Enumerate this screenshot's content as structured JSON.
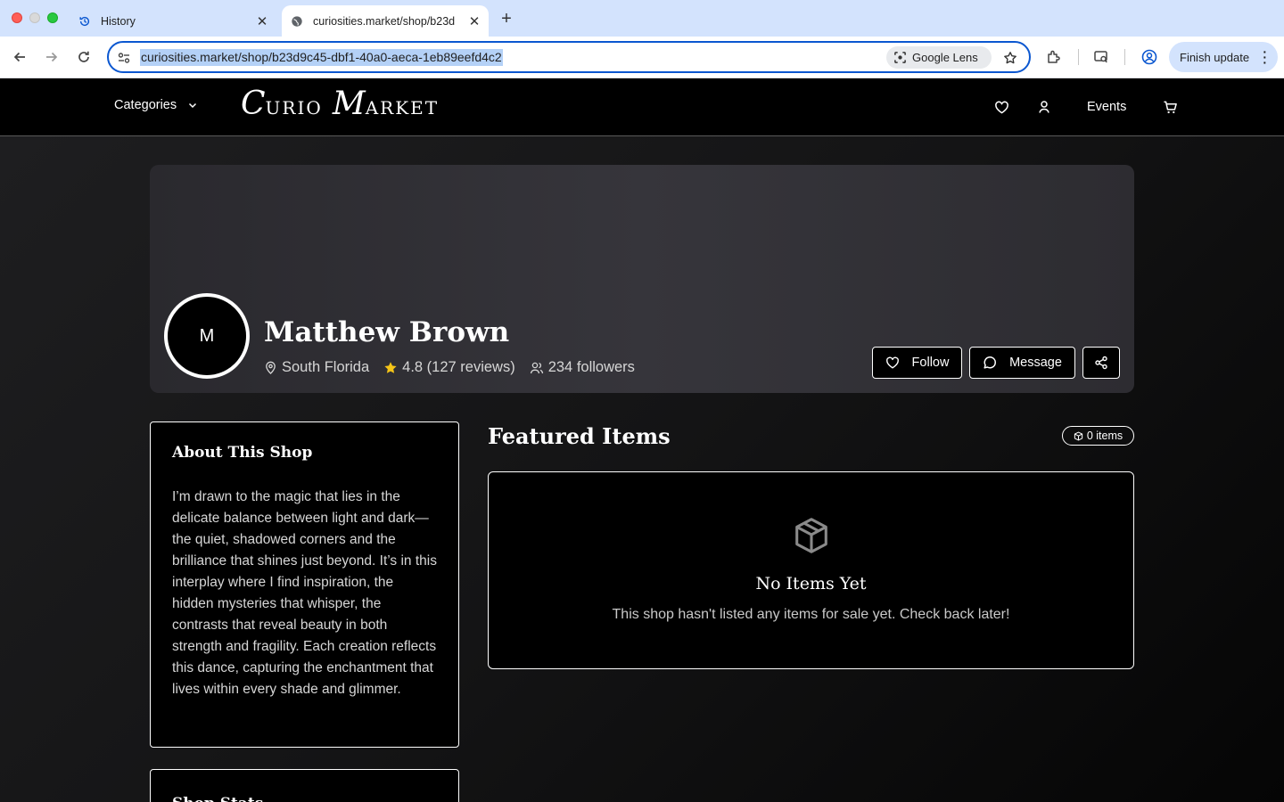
{
  "browser": {
    "tabs": [
      {
        "title": "History",
        "icon": "history-icon"
      },
      {
        "title": "curiosities.market/shop/b23d",
        "icon": "globe-icon"
      }
    ],
    "url": "curiosities.market/shop/b23d9c45-dbf1-40a0-aeca-1eb89eefd4c2",
    "lens_label": "Google Lens",
    "finish_update_label": "Finish update"
  },
  "site": {
    "categories_label": "Categories",
    "logo": {
      "c": "C",
      "urio": "URIO",
      "m": "M",
      "arket": "ARKET"
    },
    "events_label": "Events"
  },
  "shop": {
    "avatar_initial": "M",
    "name": "Matthew Brown",
    "location": "South Florida",
    "rating": "4.8 (127 reviews)",
    "followers": "234 followers",
    "follow_label": "Follow",
    "message_label": "Message",
    "rating_star_color": "#f5c518"
  },
  "about": {
    "title": "About This Shop",
    "text": "I’m drawn to the magic that lies in the delicate balance between light and dark—the quiet, shadowed corners and the brilliance that shines just beyond. It’s in this interplay where I find inspiration, the hidden mysteries that whisper, the contrasts that reveal beauty in both strength and fragility. Each creation reflects this dance, capturing the enchantment that lives within every shade and glimmer."
  },
  "stats": {
    "title": "Shop Stats"
  },
  "featured": {
    "title": "Featured Items",
    "count": "0 items",
    "empty_title": "No Items Yet",
    "empty_text": "This shop hasn't listed any items for sale yet. Check back later!"
  }
}
